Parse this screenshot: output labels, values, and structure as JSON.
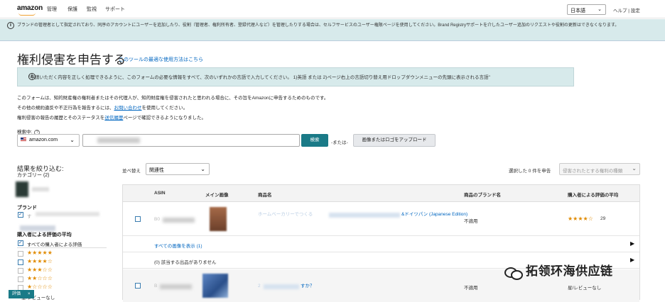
{
  "header": {
    "logo": "amazon",
    "nav": [
      "管理",
      "保護",
      "監視",
      "サポート"
    ],
    "language": "日本語",
    "links": "ヘルプ | 設定"
  },
  "banner": {
    "text": "ブランドの管理者として指定されており、同序のアカウントにユーザーを追加したり、役割（管理者、権利所有者、登録代理人など）を管理したりする場合は、セルフサービスのユーザー権限ページを使用してください。Brand Registryサポートを介したユーザー追加のリクエストや役割の更新はできなくなります。"
  },
  "page": {
    "title": "権利侵害を申告する",
    "title_link": "このツールの最適な使用方法はこちら",
    "notice": "\"申請いただく内容を正しく処理できるように、このフォームの必要な情報をすべて、次のいずれかの言語で入力してください。 1)英語 または 2)ページ右上の言語切り替え用ドロップダウンメニューの先頭に表示される言語\"",
    "para1": "このフォームは、知的財産権の権利者またはその代理人が、知的財産権を侵害されたと思われる場合に、その旨をAmazonに申告するためのものです。",
    "para2_pre": "その他の規約違反や不正行為を報告するには、",
    "para2_link": "お問い合わせ",
    "para2_post": "を使用してください。",
    "para3_pre": "権利侵害の報告の履歴とそのステータスを",
    "para3_link": "送信履歴",
    "para3_post": "ページで確認できるようになりました。"
  },
  "search": {
    "label": "検索中:",
    "help_icon": "?",
    "marketplace": "amazon.com",
    "button": "検索",
    "or_text": "-または-",
    "upload_button": "画像またはロゴをアップロード"
  },
  "filters": {
    "title": "結果を絞り込む:",
    "category_label": "カテゴリー (2)",
    "brand_label": "ブランド",
    "brand_item": "す",
    "rating_title": "購入者による評価の平均",
    "rating_all": "すべての購入者による評価",
    "star_rows": [
      "★★★★★",
      "★★★★☆",
      "★★★☆☆",
      "★★☆☆☆",
      "★☆☆☆☆"
    ],
    "rating_last": "星/レビューなし",
    "eval_tab": "評価",
    "eval_close": "×"
  },
  "results": {
    "sort_label": "並べ替え",
    "sort_value": "関連性",
    "selected_label": "選択した 0 件を申告",
    "report_placeholder": "侵害されたとする権利の種類",
    "columns": [
      "ASIN",
      "メイン画像",
      "商品名",
      "商品のブランド名",
      "購入者による評価の平均"
    ],
    "rows": [
      {
        "asin": "B0",
        "title_visible": "ホームベーカリーでつくる",
        "title_tail": "&ドイツパン (Japanese Edition)",
        "brand": "不適用",
        "stars": "★★★★☆",
        "review_count": "29",
        "show_images": "すべての画像を表示 (1)",
        "no_related": "(0) 該当する出品がありません"
      },
      {
        "asin": "B",
        "title_visible": "2",
        "title_tail": "すか？",
        "brand": "不適用",
        "review_text": "星/レビューなし"
      }
    ]
  },
  "watermark": "拓领环海供应链",
  "colors": {
    "accent": "#1a7a87",
    "banner_bg": "#d7eaeb",
    "link": "#0066c0",
    "star": "#e08a00"
  }
}
